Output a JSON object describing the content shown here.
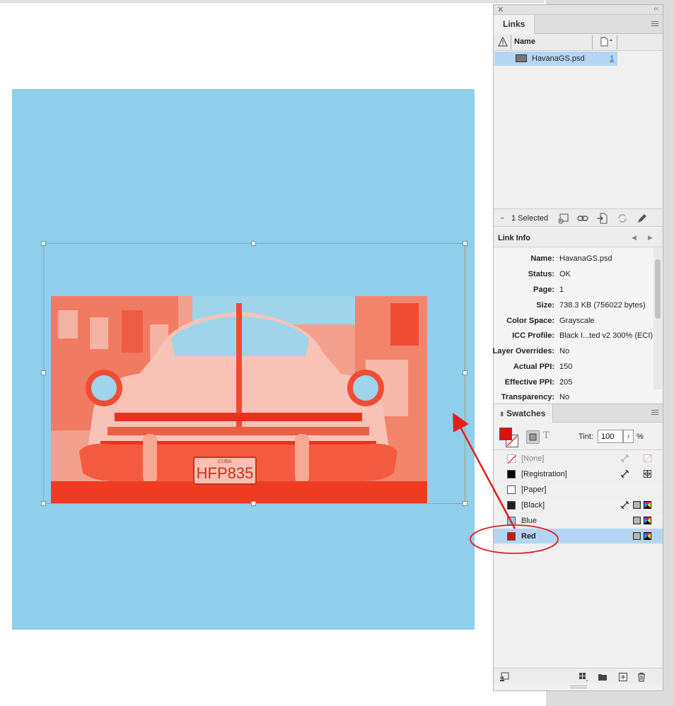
{
  "links_panel": {
    "tab_label": "Links",
    "column_name": "Name",
    "rows": [
      {
        "name": "HavanaGS.psd",
        "page": "1"
      }
    ],
    "selection_label": "1 Selected"
  },
  "link_info": {
    "title": "Link Info",
    "fields": [
      {
        "key": "Name:",
        "value": "HavanaGS.psd"
      },
      {
        "key": "Status:",
        "value": "OK"
      },
      {
        "key": "Page:",
        "value": "1"
      },
      {
        "key": "Size:",
        "value": "738.3 KB (756022 bytes)"
      },
      {
        "key": "Color Space:",
        "value": "Grayscale"
      },
      {
        "key": "ICC Profile:",
        "value": "Black I...ted v2 300% (ECI)"
      },
      {
        "key": "Layer Overrides:",
        "value": "No"
      },
      {
        "key": "Actual PPI:",
        "value": "150"
      },
      {
        "key": "Effective PPI:",
        "value": "205"
      },
      {
        "key": "Transparency:",
        "value": "No"
      }
    ]
  },
  "swatches_panel": {
    "tab_label": "Swatches",
    "tint_label": "Tint:",
    "tint_value": "100",
    "tint_unit": "%",
    "swatches": [
      {
        "name": "[None]",
        "color": "none"
      },
      {
        "name": "[Registration]",
        "color": "#000000"
      },
      {
        "name": "[Paper]",
        "color": "#ffffff"
      },
      {
        "name": "[Black]",
        "color": "#231f20"
      },
      {
        "name": "Blue",
        "color": "#8fcfeb"
      },
      {
        "name": "Red",
        "color": "#dd1111"
      }
    ]
  },
  "colors": {
    "page_background": "#8fcfeb",
    "image_tint": "#f0321e",
    "annotation": "#e41e1e",
    "selection_highlight": "#b5d5f3"
  },
  "photo_plate_text": "HFP835",
  "photo_plate_header": "CUBA"
}
